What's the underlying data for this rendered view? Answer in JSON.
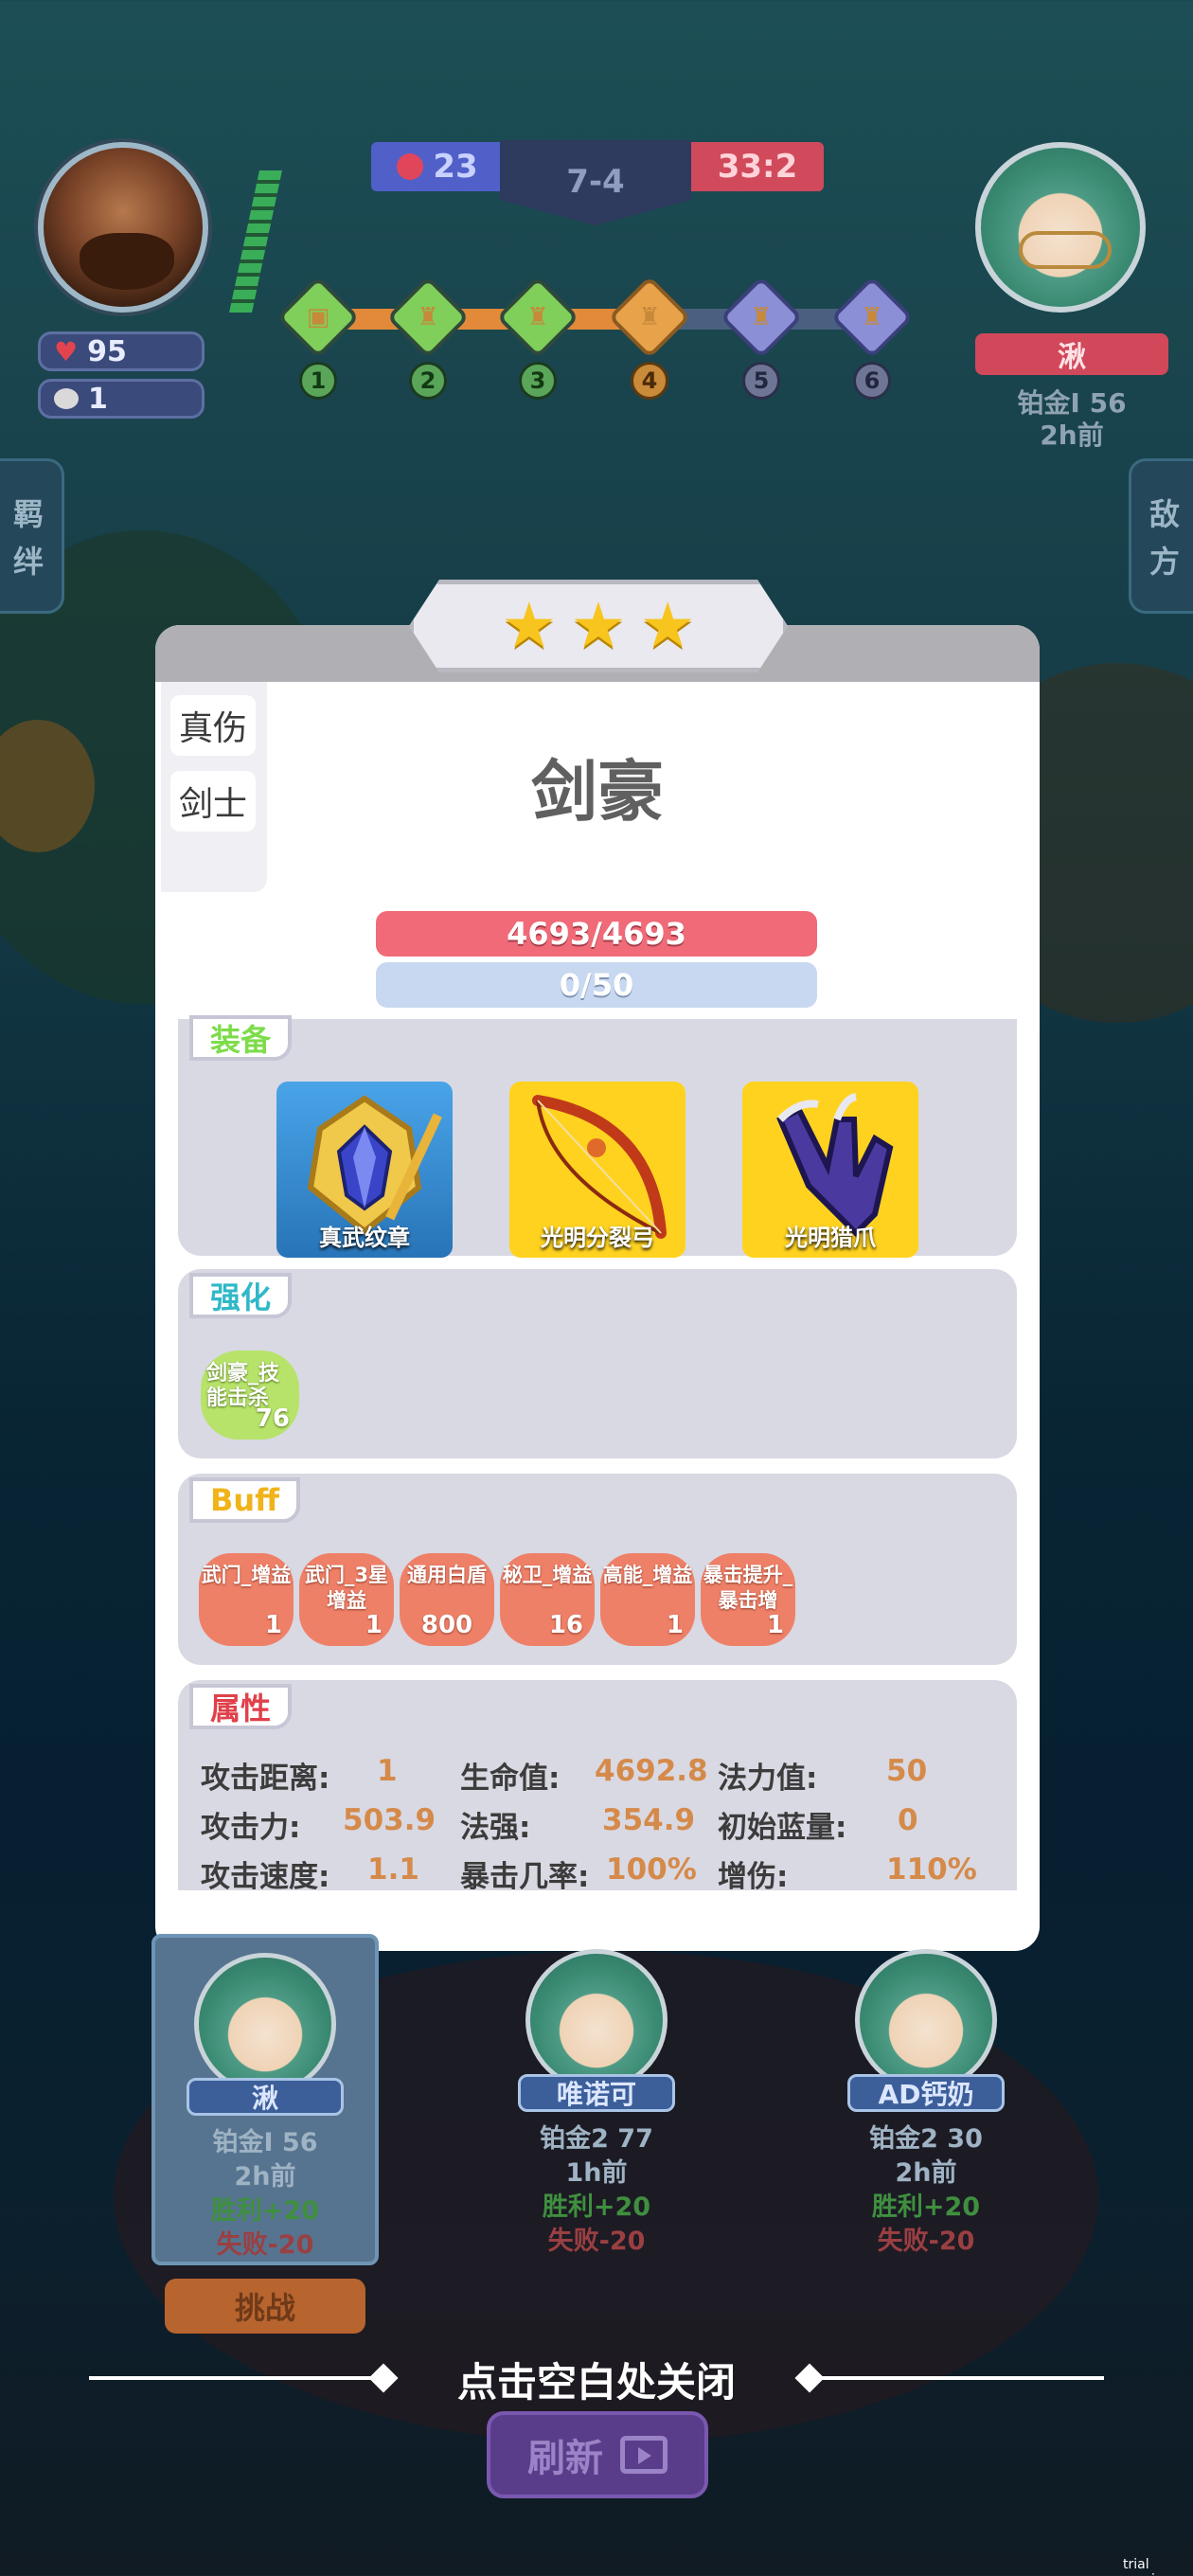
{
  "hud": {
    "player": {
      "hp": "95",
      "coins": "1"
    },
    "score_left": "23",
    "stage": "7-4",
    "score_right": "33:2",
    "rounds": [
      "1",
      "2",
      "3",
      "4",
      "5",
      "6"
    ],
    "enemy": {
      "name": "湫",
      "rank": "铂金Ⅰ 56",
      "time": "2h前"
    },
    "left_tab": [
      "羁",
      "绊"
    ],
    "right_tab": [
      "敌",
      "方"
    ]
  },
  "hero": {
    "stars": 3,
    "tags": [
      "真伤",
      "剑士"
    ],
    "name": "剑豪",
    "hp": "4693/4693",
    "mana": "0/50"
  },
  "equipment": {
    "label": "装备",
    "items": [
      {
        "name": "真武纹章",
        "icon": "emblem-icon"
      },
      {
        "name": "光明分裂弓",
        "icon": "bow-icon"
      },
      {
        "name": "光明猎爪",
        "icon": "claw-icon"
      }
    ]
  },
  "enhance": {
    "label": "强化",
    "items": [
      {
        "name": "剑豪_技能击杀",
        "value": "76"
      }
    ]
  },
  "buff": {
    "label": "Buff",
    "items": [
      {
        "name": "武门_增益",
        "value": "1"
      },
      {
        "name": "武门_3星增益",
        "value": "1"
      },
      {
        "name": "通用白盾",
        "value": "800"
      },
      {
        "name": "秘卫_增益",
        "value": "16"
      },
      {
        "name": "高能_增益",
        "value": "1"
      },
      {
        "name": "暴击提升_暴击增",
        "value": "1"
      }
    ]
  },
  "attributes": {
    "label": "属性",
    "items": [
      {
        "key": "攻击距离:",
        "value": "1"
      },
      {
        "key": "生命值:",
        "value": "4692.8"
      },
      {
        "key": "法力值:",
        "value": "50"
      },
      {
        "key": "攻击力:",
        "value": "503.9"
      },
      {
        "key": "法强:",
        "value": "354.9"
      },
      {
        "key": "初始蓝量:",
        "value": "0"
      },
      {
        "key": "攻击速度:",
        "value": "1.1"
      },
      {
        "key": "暴击几率:",
        "value": "100%"
      },
      {
        "key": "增伤:",
        "value": "110%"
      }
    ]
  },
  "opponents": [
    {
      "name": "湫",
      "rank": "铂金Ⅰ 56",
      "time": "2h前",
      "win": "胜利+20",
      "lose": "失败-20"
    },
    {
      "name": "唯诺可",
      "rank": "铂金2 77",
      "time": "1h前",
      "win": "胜利+20",
      "lose": "失败-20"
    },
    {
      "name": "AD钙奶",
      "rank": "铂金2 30",
      "time": "2h前",
      "win": "胜利+20",
      "lose": "失败-20"
    }
  ],
  "actions": {
    "challenge": "挑战",
    "close_hint": "点击空白处关闭",
    "refresh": "刷新"
  },
  "watermark": "trial version",
  "colors": {
    "hp_bar": "#f06a78",
    "mana_bar": "#c8d8f0",
    "attr_value": "#d58a4a"
  }
}
